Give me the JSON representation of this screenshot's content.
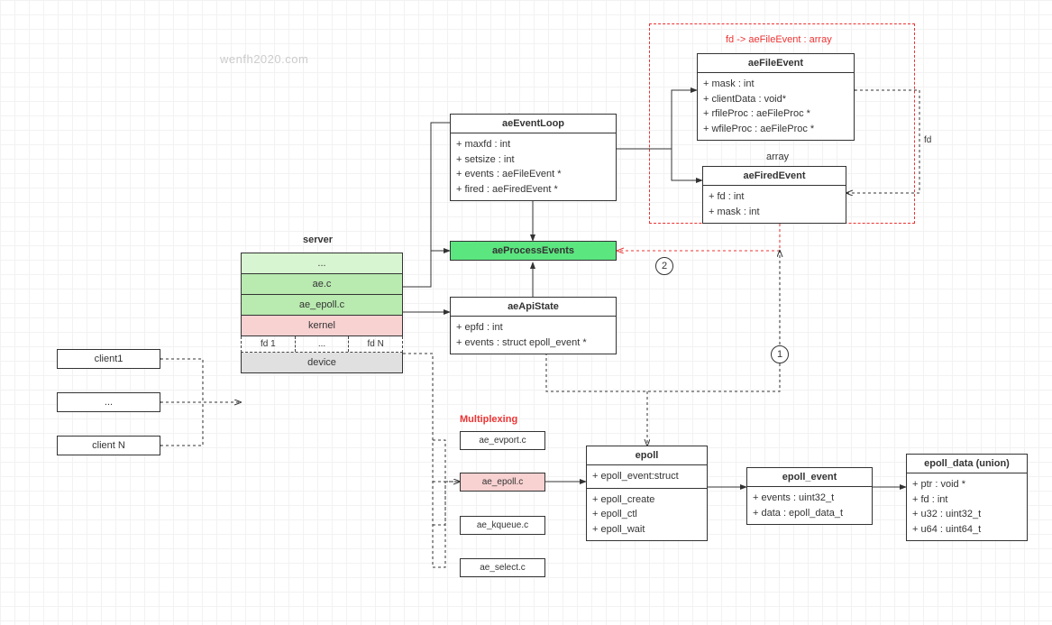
{
  "watermark": "wenfh2020.com",
  "serverTitle": "server",
  "serverStack": [
    "...",
    "ae.c",
    "ae_epoll.c",
    "kernel"
  ],
  "fdRow": [
    "fd 1",
    "...",
    "fd N"
  ],
  "deviceRow": "device",
  "clients": [
    "client1",
    "...",
    "client N"
  ],
  "aeEventLoop": {
    "title": "aeEventLoop",
    "rows": [
      "+ maxfd : int",
      "+ setsize : int",
      "+ events : aeFileEvent *",
      "+ fired : aeFiredEvent *"
    ]
  },
  "aeProcessEvents": "aeProcessEvents",
  "aeApiState": {
    "title": "aeApiState",
    "rows": [
      "+ epfd : int",
      "+ events : struct epoll_event *"
    ]
  },
  "redGroupLabel": "fd -> aeFileEvent : array",
  "aeFileEvent": {
    "title": "aeFileEvent",
    "rows": [
      "+ mask : int",
      "+ clientData : void*",
      "+ rfileProc : aeFileProc *",
      "+ wfileProc : aeFileProc *"
    ]
  },
  "arrayLabel": "array",
  "aeFiredEvent": {
    "title": "aeFiredEvent",
    "rows": [
      "+ fd : int",
      "+ mask : int"
    ]
  },
  "fdLabel": "fd",
  "multiplexingTitle": "Multiplexing",
  "muxList": [
    "ae_evport.c",
    "ae_epoll.c",
    "ae_kqueue.c",
    "ae_select.c"
  ],
  "epoll": {
    "title": "epoll",
    "rows1": [
      "+ epoll_event:struct"
    ],
    "rows2": [
      "+ epoll_create",
      "+ epoll_ctl",
      "+ epoll_wait"
    ]
  },
  "epoll_event": {
    "title": "epoll_event",
    "rows": [
      "+ events : uint32_t",
      "+ data : epoll_data_t"
    ]
  },
  "epoll_data": {
    "title": "epoll_data (union)",
    "rows": [
      "+ ptr : void *",
      "+ fd : int",
      "+ u32 : uint32_t",
      "+ u64 : uint64_t"
    ]
  },
  "badge1": "1",
  "badge2": "2"
}
